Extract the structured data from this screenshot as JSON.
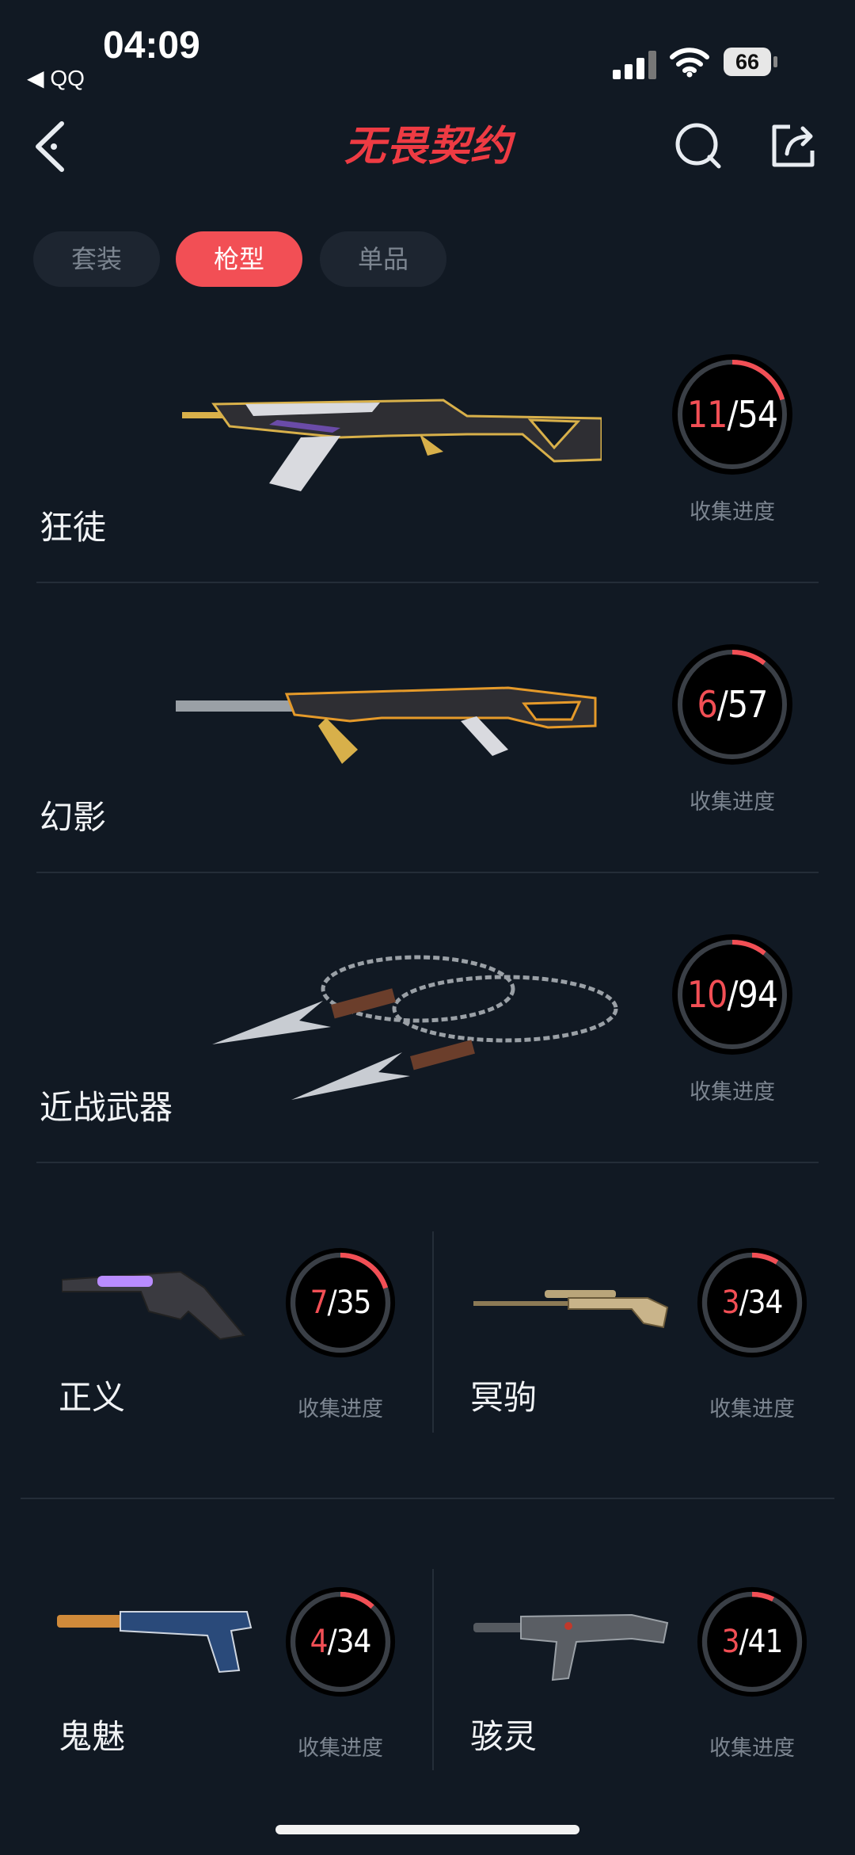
{
  "status_bar": {
    "time": "04:09",
    "back_app": "◀ QQ",
    "battery": "66"
  },
  "header": {
    "title": "无畏契约"
  },
  "tabs": [
    {
      "label": "套装",
      "active": false
    },
    {
      "label": "枪型",
      "active": true
    },
    {
      "label": "单品",
      "active": false
    }
  ],
  "progress_label": "收集进度",
  "weapons": [
    {
      "name": "狂徒",
      "collected": "11",
      "total": "54",
      "fraction": 0.204
    },
    {
      "name": "幻影",
      "collected": "6",
      "total": "57",
      "fraction": 0.105
    },
    {
      "name": "近战武器",
      "collected": "10",
      "total": "94",
      "fraction": 0.106
    },
    {
      "name": "正义",
      "collected": "7",
      "total": "35",
      "fraction": 0.2
    },
    {
      "name": "冥驹",
      "collected": "3",
      "total": "34",
      "fraction": 0.088
    },
    {
      "name": "鬼魅",
      "collected": "4",
      "total": "34",
      "fraction": 0.118
    },
    {
      "name": "骇灵",
      "collected": "3",
      "total": "41",
      "fraction": 0.073
    }
  ],
  "colors": {
    "accent": "#f24f55",
    "background": "#111923",
    "ring_track": "#3a3f46"
  }
}
